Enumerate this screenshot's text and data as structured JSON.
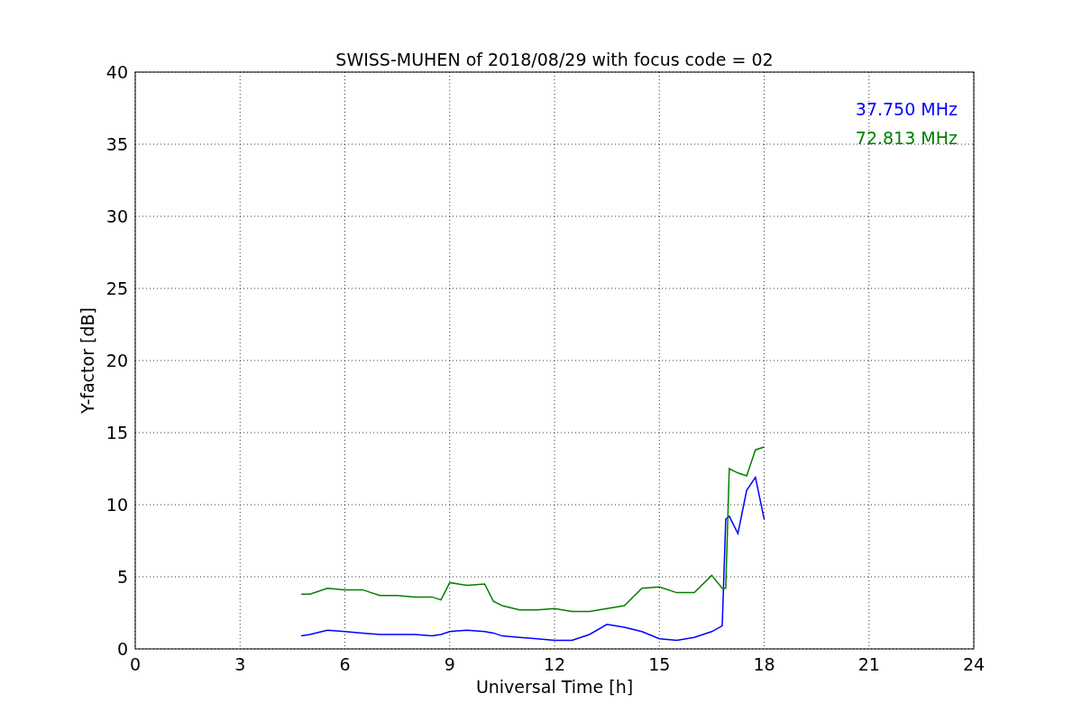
{
  "chart_data": {
    "type": "line",
    "title": "SWISS-MUHEN of 2018/08/29 with focus code = 02",
    "xlabel": "Universal Time [h]",
    "ylabel": "Y-factor [dB]",
    "x": [
      4.75,
      5,
      5.5,
      6,
      6.5,
      7,
      7.5,
      8,
      8.5,
      8.75,
      9,
      9.5,
      10,
      10.25,
      10.5,
      11,
      11.5,
      12,
      12.5,
      13,
      13.5,
      14,
      14.5,
      15,
      15.5,
      16,
      16.5,
      16.8,
      16.9,
      17,
      17.25,
      17.5,
      17.75,
      18
    ],
    "series": [
      {
        "name": "37.750 MHz",
        "color": "#0000ff",
        "values": [
          0.9,
          1.0,
          1.3,
          1.2,
          1.1,
          1.0,
          1.0,
          1.0,
          0.9,
          1.0,
          1.2,
          1.3,
          1.2,
          1.1,
          0.9,
          0.8,
          0.7,
          0.6,
          0.6,
          1.0,
          1.7,
          1.5,
          1.2,
          0.7,
          0.6,
          0.8,
          1.2,
          1.6,
          9.0,
          9.2,
          8.0,
          11.0,
          11.9,
          9.0
        ]
      },
      {
        "name": "72.813 MHz",
        "color": "#008000",
        "values": [
          3.8,
          3.8,
          4.2,
          4.1,
          4.1,
          3.7,
          3.7,
          3.6,
          3.6,
          3.4,
          4.6,
          4.4,
          4.5,
          3.3,
          3.0,
          2.7,
          2.7,
          2.8,
          2.6,
          2.6,
          2.8,
          3.0,
          4.2,
          4.3,
          3.9,
          3.9,
          5.1,
          4.2,
          4.2,
          12.5,
          12.2,
          12.0,
          13.8,
          14.0
        ]
      }
    ],
    "grid": true,
    "xlim": [
      0,
      24
    ],
    "ylim": [
      0,
      40
    ],
    "xticks": [
      0,
      3,
      6,
      9,
      12,
      15,
      18,
      21,
      24
    ],
    "yticks": [
      0,
      5,
      10,
      15,
      20,
      25,
      30,
      35,
      40
    ]
  }
}
